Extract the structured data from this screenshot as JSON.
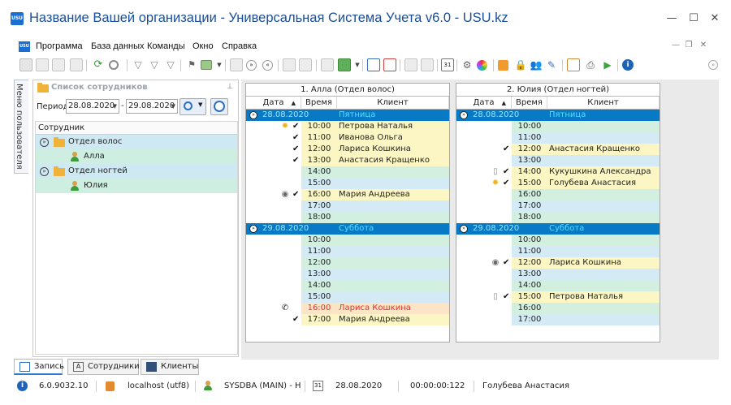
{
  "window": {
    "title": "Название Вашей организации - Универсальная Система Учета v6.0 - USU.kz",
    "logo_text": "USU",
    "minimize": "—",
    "maximize": "☐",
    "close": "✕"
  },
  "menu": {
    "items": [
      "Программа",
      "База данных",
      "Команды",
      "Окно",
      "Справка"
    ],
    "mdi_minimize": "—",
    "mdi_restore": "❐",
    "mdi_close": "✕"
  },
  "side_tab": {
    "label": "Меню пользователя"
  },
  "left_panel": {
    "title": "Список сотрудников",
    "pin": "⊥",
    "period_label": "Период",
    "date_from": "28.08.2020",
    "date_to": "29.08.2020",
    "dash": "-",
    "tree_header": "Сотрудник",
    "tree": [
      {
        "type": "dep",
        "label": "Отдел волос"
      },
      {
        "type": "emp",
        "label": "Алла"
      },
      {
        "type": "dep",
        "label": "Отдел ногтей"
      },
      {
        "type": "emp",
        "label": "Юлия"
      }
    ]
  },
  "schedules": [
    {
      "title": "1. Алла (Отдел волос)",
      "col_date": "Дата",
      "col_time": "Время",
      "col_client": "Клиент",
      "days": [
        {
          "date": "28.08.2020",
          "weekday": "Пятница",
          "slots": [
            {
              "time": "10:00",
              "client": "Петрова Наталья",
              "status": "sun",
              "check": true,
              "color": "yellow"
            },
            {
              "time": "11:00",
              "client": "Иванова Ольга",
              "status": "",
              "check": true,
              "color": "yellow"
            },
            {
              "time": "12:00",
              "client": "Лариса Кошкина",
              "status": "",
              "check": true,
              "color": "yellow"
            },
            {
              "time": "13:00",
              "client": "Анастасия Кращенко",
              "status": "",
              "check": true,
              "color": "yellow"
            },
            {
              "time": "14:00",
              "client": "",
              "status": "",
              "check": false,
              "color": ""
            },
            {
              "time": "15:00",
              "client": "",
              "status": "",
              "check": false,
              "color": ""
            },
            {
              "time": "16:00",
              "client": "Мария Андреева",
              "status": "eye",
              "check": true,
              "color": "yellow"
            },
            {
              "time": "17:00",
              "client": "",
              "status": "",
              "check": false,
              "color": ""
            },
            {
              "time": "18:00",
              "client": "",
              "status": "",
              "check": false,
              "color": ""
            }
          ]
        },
        {
          "date": "29.08.2020",
          "weekday": "Суббота",
          "slots": [
            {
              "time": "10:00",
              "client": "",
              "status": "",
              "check": false,
              "color": ""
            },
            {
              "time": "11:00",
              "client": "",
              "status": "",
              "check": false,
              "color": ""
            },
            {
              "time": "12:00",
              "client": "",
              "status": "",
              "check": false,
              "color": ""
            },
            {
              "time": "13:00",
              "client": "",
              "status": "",
              "check": false,
              "color": ""
            },
            {
              "time": "14:00",
              "client": "",
              "status": "",
              "check": false,
              "color": ""
            },
            {
              "time": "15:00",
              "client": "",
              "status": "",
              "check": false,
              "color": ""
            },
            {
              "time": "16:00",
              "client": "Лариса Кошкина",
              "status": "phone",
              "check": false,
              "color": "salmon"
            },
            {
              "time": "17:00",
              "client": "Мария Андреева",
              "status": "",
              "check": true,
              "color": "yellow"
            }
          ]
        }
      ]
    },
    {
      "title": "2. Юлия (Отдел ногтей)",
      "col_date": "Дата",
      "col_time": "Время",
      "col_client": "Клиент",
      "days": [
        {
          "date": "28.08.2020",
          "weekday": "Пятница",
          "slots": [
            {
              "time": "10:00",
              "client": "",
              "status": "",
              "check": false,
              "color": ""
            },
            {
              "time": "11:00",
              "client": "",
              "status": "",
              "check": false,
              "color": ""
            },
            {
              "time": "12:00",
              "client": "Анастасия Кращенко",
              "status": "",
              "check": true,
              "color": "yellow"
            },
            {
              "time": "13:00",
              "client": "",
              "status": "",
              "check": false,
              "color": ""
            },
            {
              "time": "14:00",
              "client": "Кукушкина Александра",
              "status": "doc",
              "check": true,
              "color": "yellow"
            },
            {
              "time": "15:00",
              "client": "Голубева Анастасия",
              "status": "sun",
              "check": true,
              "color": "yellow"
            },
            {
              "time": "16:00",
              "client": "",
              "status": "",
              "check": false,
              "color": ""
            },
            {
              "time": "17:00",
              "client": "",
              "status": "",
              "check": false,
              "color": ""
            },
            {
              "time": "18:00",
              "client": "",
              "status": "",
              "check": false,
              "color": ""
            }
          ]
        },
        {
          "date": "29.08.2020",
          "weekday": "Суббота",
          "slots": [
            {
              "time": "10:00",
              "client": "",
              "status": "",
              "check": false,
              "color": ""
            },
            {
              "time": "11:00",
              "client": "",
              "status": "",
              "check": false,
              "color": ""
            },
            {
              "time": "12:00",
              "client": "Лариса Кошкина",
              "status": "eye",
              "check": true,
              "color": "yellow"
            },
            {
              "time": "13:00",
              "client": "",
              "status": "",
              "check": false,
              "color": ""
            },
            {
              "time": "14:00",
              "client": "",
              "status": "",
              "check": false,
              "color": ""
            },
            {
              "time": "15:00",
              "client": "Петрова Наталья",
              "status": "doc",
              "check": true,
              "color": "yellow"
            },
            {
              "time": "16:00",
              "client": "",
              "status": "",
              "check": false,
              "color": ""
            },
            {
              "time": "17:00",
              "client": "",
              "status": "",
              "check": false,
              "color": ""
            }
          ]
        }
      ]
    }
  ],
  "bottom_tabs": [
    {
      "label": "Запись",
      "icon": "calendar-icon",
      "active": true
    },
    {
      "label": "Сотрудники",
      "icon": "text-icon",
      "active": false
    },
    {
      "label": "Клиенты",
      "icon": "book-icon",
      "active": false
    }
  ],
  "statusbar": {
    "version": "6.0.9032.10",
    "db": "localhost (utf8)",
    "user": "SYSDBA (MAIN) - Н",
    "date": "28.08.2020",
    "timer": "00:00:00:122",
    "current_client": "Голубева Анастасия",
    "calendar_icon_text": "31"
  },
  "colors": {
    "day_band": "#0879c4",
    "date_text": "#9ee7ff",
    "weekday_text": "#54e0ff",
    "slot_empty_a": "#d2efe0",
    "slot_empty_b": "#d4eaf5",
    "slot_booked": "#fbf6c3",
    "slot_attention": "#fce5c6",
    "attention_text": "#e0322b"
  }
}
